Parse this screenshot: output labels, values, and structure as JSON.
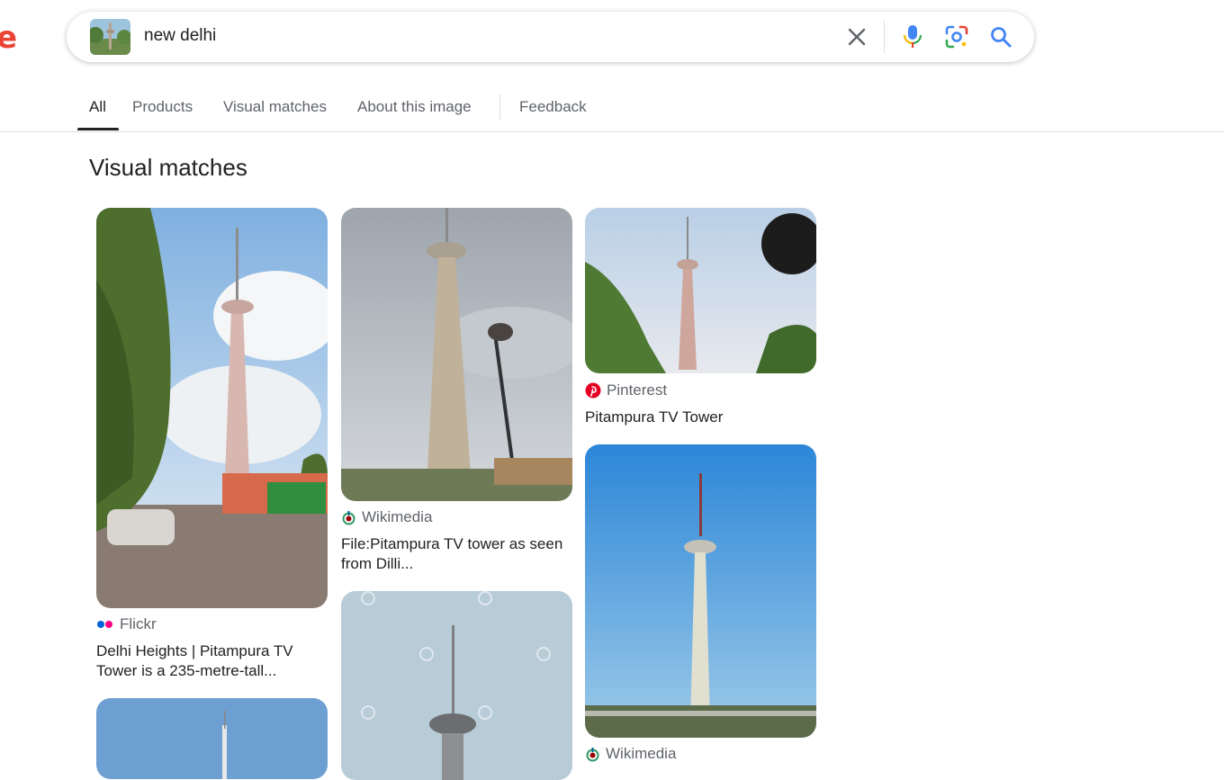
{
  "logo_fragment": "e",
  "search": {
    "query": "new delhi"
  },
  "icons": {
    "clear": "close-icon",
    "voice": "microphone-icon",
    "lens": "camera-lens-icon",
    "search": "search-icon"
  },
  "tabs": [
    {
      "label": "All",
      "active": true
    },
    {
      "label": "Products"
    },
    {
      "label": "Visual matches"
    },
    {
      "label": "About this image"
    },
    {
      "label": "Feedback"
    }
  ],
  "section_title": "Visual matches",
  "results": [
    {
      "source": "Flickr",
      "title": "Delhi Heights | Pitampura TV Tower is a 235-metre-tall..."
    },
    {
      "source": "Wikimedia",
      "title": "File:Pitampura TV tower as seen from Dilli..."
    },
    {
      "source": "Pinterest",
      "title": "Pitampura TV Tower"
    },
    {
      "source": "Wikimedia",
      "title": ""
    }
  ],
  "colors": {
    "accent_blue": "#4285f4",
    "brand_red": "#ea4335",
    "text": "#202124",
    "muted": "#5f6368"
  }
}
